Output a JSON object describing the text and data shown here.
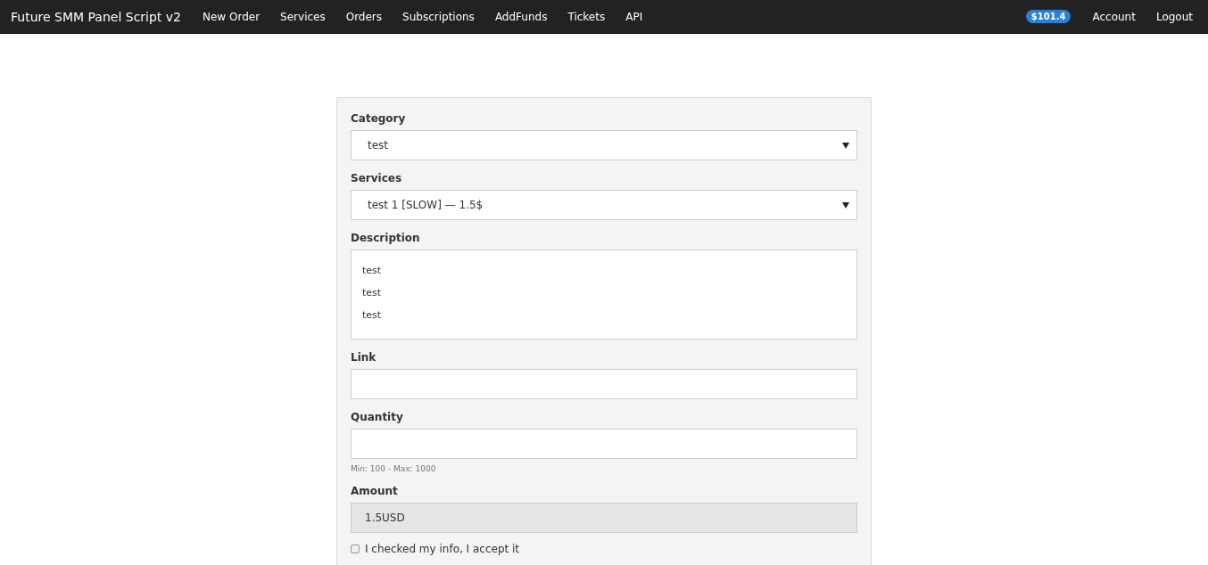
{
  "navbar": {
    "brand": "Future SMM Panel Script v2",
    "links": [
      "New Order",
      "Services",
      "Orders",
      "Subscriptions",
      "AddFunds",
      "Tickets",
      "API"
    ],
    "balance": "$101.4",
    "right_links": [
      "Account",
      "Logout"
    ]
  },
  "form": {
    "fields": [
      {
        "kind": "select",
        "label": "Category",
        "value": "test"
      },
      {
        "kind": "select",
        "label": "Services",
        "value": "test 1 [SLOW] — 1.5$"
      },
      {
        "kind": "text",
        "label": "Description",
        "lines": [
          "test",
          "test",
          "test"
        ]
      },
      {
        "kind": "input",
        "label": "Link"
      },
      {
        "kind": "input",
        "label": "Quantity",
        "hint": "Min: 100 - Max: 1000"
      },
      {
        "kind": "readonly",
        "label": "Amount",
        "value": "1.5USD"
      }
    ],
    "agree": {
      "label": "I checked my info, I accept it",
      "checked": false
    }
  }
}
